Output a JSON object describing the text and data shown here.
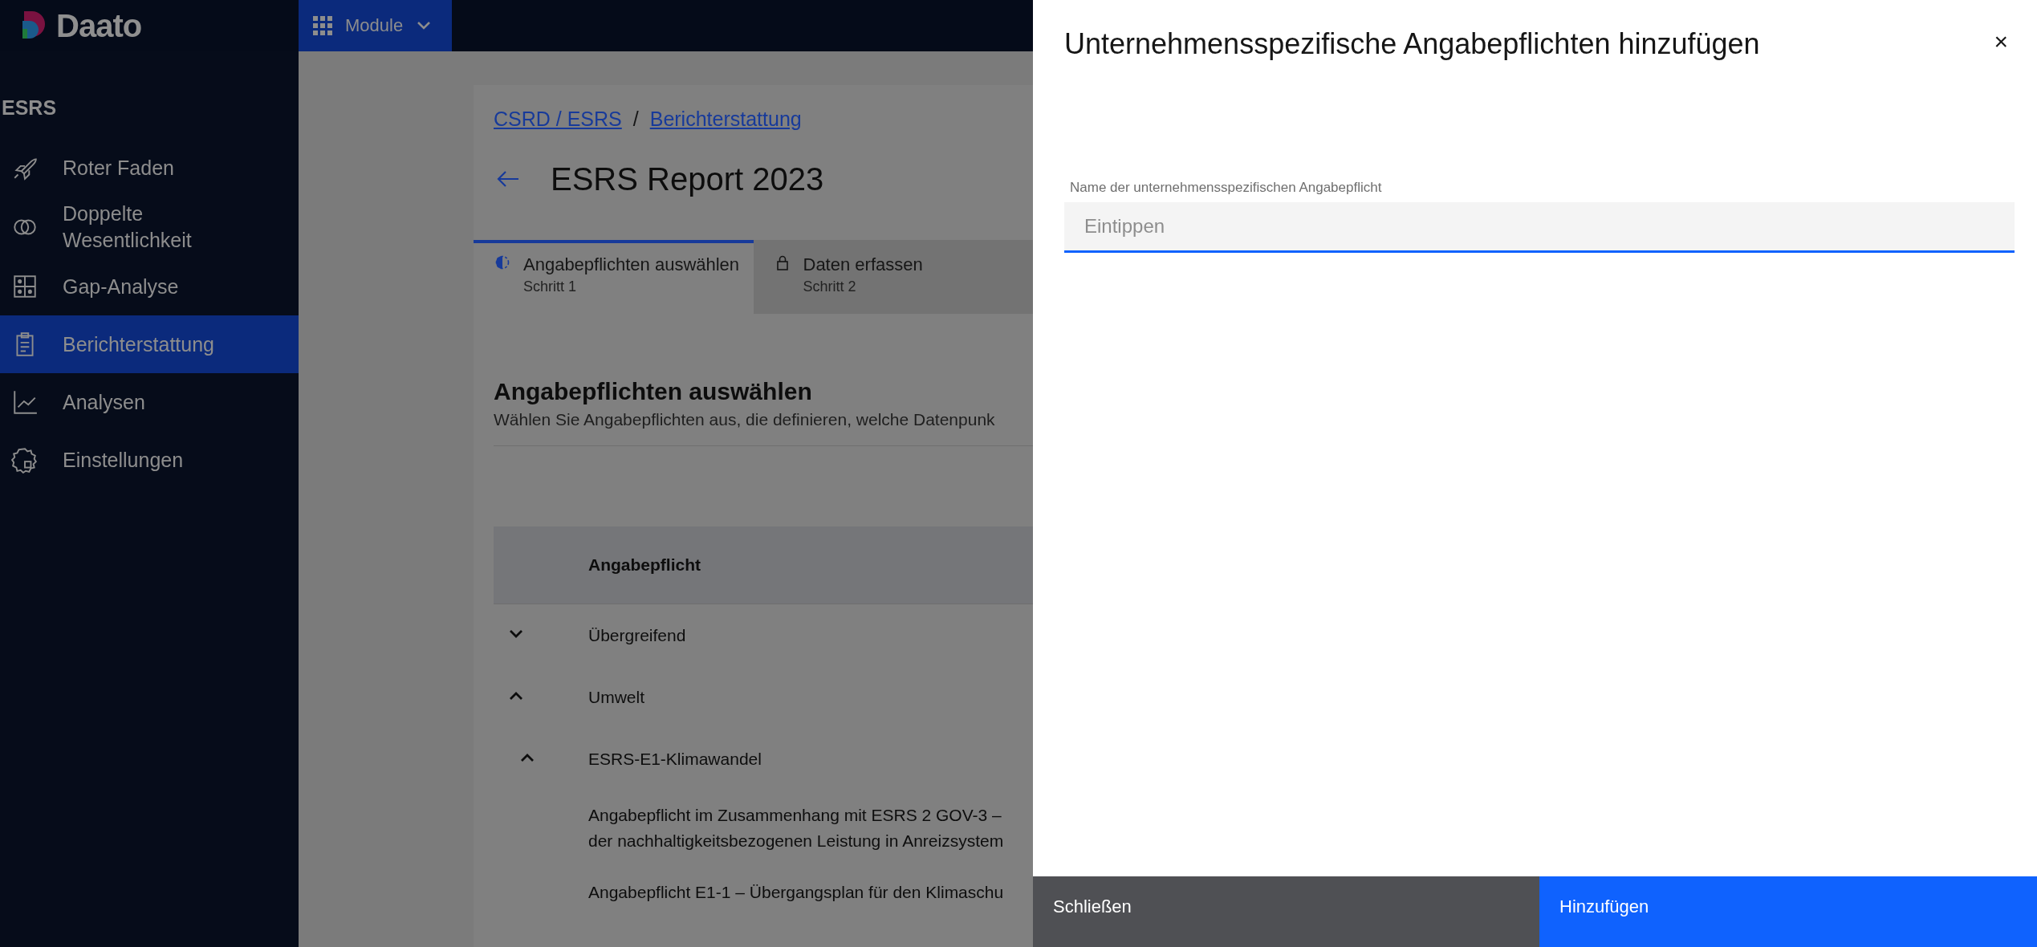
{
  "header": {
    "logo": "Daato",
    "module_button": "Module"
  },
  "sidebar": {
    "section": "ESRS",
    "items": [
      {
        "label": "Roter Faden",
        "selected": false
      },
      {
        "label": "Doppelte Wesentlichkeit",
        "selected": false
      },
      {
        "label": "Gap-Analyse",
        "selected": false
      },
      {
        "label": "Berichterstattung",
        "selected": true
      },
      {
        "label": "Analysen",
        "selected": false
      },
      {
        "label": "Einstellungen",
        "selected": false
      }
    ]
  },
  "breadcrumbs": [
    "CSRD / ESRS",
    "Berichterstattung"
  ],
  "breadcrumb_separator": "/",
  "page_title": "ESRS Report 2023",
  "steps": [
    {
      "label": "Angabepflichten auswählen",
      "sublabel": "Schritt 1",
      "kind": "in_progress",
      "selected": true
    },
    {
      "label": "Daten erfassen",
      "sublabel": "Schritt 2",
      "kind": "locked",
      "selected": false
    }
  ],
  "section": {
    "title": "Angabepflichten auswählen",
    "subtitle": "Wählen Sie Angabepflichten aus, die definieren, welche Datenpunk"
  },
  "table": {
    "columns": [
      "Angabepflicht"
    ],
    "rows": [
      {
        "label": "Übergreifend",
        "expanded": false
      },
      {
        "label": "Umwelt",
        "expanded": true,
        "children": [
          {
            "label": "ESRS-E1-Klimawandel",
            "expanded": true,
            "children": [
              {
                "lines": [
                  "Angabepflicht im Zusammenhang mit ESRS 2 GOV-3 –",
                  "der nachhaltigkeitsbezogenen Leistung in Anreizsystem"
                ]
              },
              {
                "lines": [
                  "Angabepflicht E1-1 – Übergangsplan für den Klimaschu"
                ]
              }
            ]
          }
        ]
      }
    ]
  },
  "drawer": {
    "title": "Unternehmensspezifische Angabepflichten hinzufügen",
    "close": "×",
    "field": {
      "label": "Name der unternehmensspezifischen Angabepflicht",
      "placeholder": "Eintippen"
    },
    "buttons": [
      {
        "label": "Schließen",
        "kind": "secondary"
      },
      {
        "label": "Hinzufügen",
        "kind": "primary"
      }
    ]
  }
}
